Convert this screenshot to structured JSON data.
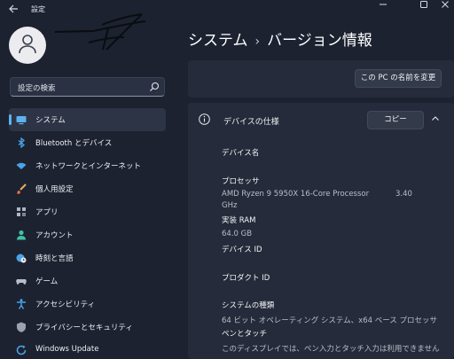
{
  "window": {
    "title": "設定",
    "back_icon": "back-arrow-icon",
    "controls": [
      "minimize-icon",
      "maximize-icon",
      "close-icon"
    ]
  },
  "profile": {
    "avatar_icon": "person-icon"
  },
  "search": {
    "placeholder": "設定の検索",
    "icon": "search-icon"
  },
  "sidebar": {
    "items": [
      {
        "label": "システム",
        "icon": "monitor-icon",
        "selected": true
      },
      {
        "label": "Bluetooth とデバイス",
        "icon": "bluetooth-icon"
      },
      {
        "label": "ネットワークとインターネット",
        "icon": "wifi-icon"
      },
      {
        "label": "個人用設定",
        "icon": "brush-icon"
      },
      {
        "label": "アプリ",
        "icon": "apps-icon"
      },
      {
        "label": "アカウント",
        "icon": "account-icon"
      },
      {
        "label": "時刻と言語",
        "icon": "globe-clock-icon"
      },
      {
        "label": "ゲーム",
        "icon": "gamepad-icon"
      },
      {
        "label": "アクセシビリティ",
        "icon": "accessibility-icon"
      },
      {
        "label": "プライバシーとセキュリティ",
        "icon": "shield-icon"
      },
      {
        "label": "Windows Update",
        "icon": "update-icon"
      }
    ]
  },
  "header": {
    "breadcrumb_parent": "システム",
    "separator": "›",
    "breadcrumb_current": "バージョン情報"
  },
  "rename": {
    "button_label": "この PC の名前を変更"
  },
  "specs": {
    "title": "デバイスの仕様",
    "copy_label": "コピー",
    "device_name_label": "デバイス名",
    "processor_label": "プロセッサ",
    "processor_value": "AMD Ryzen 9 5950X 16-Core Processor",
    "processor_value_cont": "GHz",
    "processor_speed": "3.40",
    "ram_label": "実装 RAM",
    "ram_value": "64.0 GB",
    "device_id_label": "デバイス ID",
    "product_id_label": "プロダクト ID",
    "system_type_label": "システムの種類",
    "system_type_value": "64 ビット オペレーティング システム、x64 ベース プロセッサ",
    "pen_touch_label": "ペンとタッチ",
    "pen_touch_value": "このディスプレイでは、ペン入力とタッチ入力は利用できません"
  },
  "colors": {
    "background": "#1c2230",
    "card": "#252b3a",
    "accent": "#5fb2f2",
    "selected_item": "#2d3445"
  }
}
